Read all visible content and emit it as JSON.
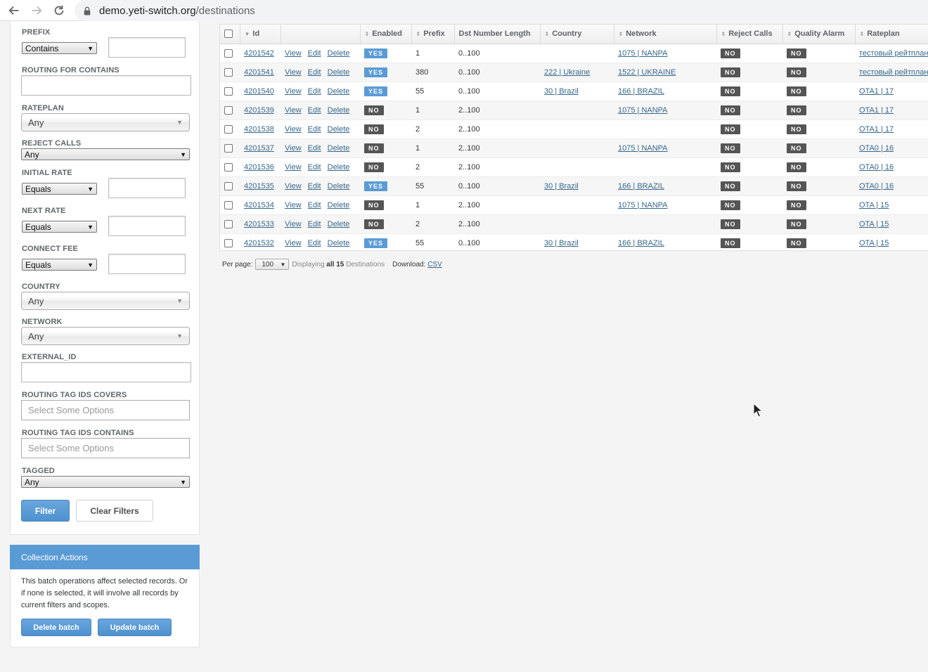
{
  "browser": {
    "url_host": "demo.yeti-switch.org",
    "url_path": "/destinations"
  },
  "filters": {
    "prefix_label": "PREFIX",
    "prefix_op": "Contains",
    "routing_for_contains_label": "ROUTING FOR CONTAINS",
    "rateplan_label": "RATEPLAN",
    "rateplan_value": "Any",
    "reject_calls_label": "REJECT CALLS",
    "reject_calls_value": "Any",
    "initial_rate_label": "INITIAL RATE",
    "initial_rate_op": "Equals",
    "next_rate_label": "NEXT RATE",
    "next_rate_op": "Equals",
    "connect_fee_label": "CONNECT FEE",
    "connect_fee_op": "Equals",
    "country_label": "COUNTRY",
    "country_value": "Any",
    "network_label": "NETWORK",
    "network_value": "Any",
    "external_id_label": "EXTERNAL_ID",
    "tag_covers_label": "ROUTING TAG IDS COVERS",
    "tag_covers_placeholder": "Select Some Options",
    "tag_contains_label": "ROUTING TAG IDS CONTAINS",
    "tag_contains_placeholder": "Select Some Options",
    "tagged_label": "TAGGED",
    "tagged_value": "Any",
    "filter_button": "Filter",
    "clear_button": "Clear Filters"
  },
  "collection_actions": {
    "title": "Collection Actions",
    "text": "This batch operations affect selected records. Or if none is selected, it will involve all records by current filters and scopes.",
    "delete_batch": "Delete batch",
    "update_batch": "Update batch"
  },
  "table": {
    "headers": [
      "Id",
      "",
      "Enabled",
      "Prefix",
      "Dst Number Length",
      "Country",
      "Network",
      "Reject Calls",
      "Quality Alarm",
      "Rateplan"
    ],
    "action_labels": [
      "View",
      "Edit",
      "Delete"
    ],
    "rows": [
      {
        "id": "4201542",
        "enabled": "YES",
        "prefix": "1",
        "len": "0..100",
        "country": "",
        "network": "1075 | NANPA",
        "reject": "NO",
        "alarm": "NO",
        "rateplan": "тестовый рейтплан"
      },
      {
        "id": "4201541",
        "enabled": "YES",
        "prefix": "380",
        "len": "0..100",
        "country": "222 | Ukraine",
        "network": "1522 | UKRAINE",
        "reject": "NO",
        "alarm": "NO",
        "rateplan": "тестовый рейтплан"
      },
      {
        "id": "4201540",
        "enabled": "YES",
        "prefix": "55",
        "len": "0..100",
        "country": "30 | Brazil",
        "network": "166 | BRAZIL",
        "reject": "NO",
        "alarm": "NO",
        "rateplan": "OTA1 | 17"
      },
      {
        "id": "4201539",
        "enabled": "NO",
        "prefix": "1",
        "len": "2..100",
        "country": "",
        "network": "1075 | NANPA",
        "reject": "NO",
        "alarm": "NO",
        "rateplan": "OTA1 | 17"
      },
      {
        "id": "4201538",
        "enabled": "NO",
        "prefix": "2",
        "len": "2..100",
        "country": "",
        "network": "",
        "reject": "NO",
        "alarm": "NO",
        "rateplan": "OTA1 | 17"
      },
      {
        "id": "4201537",
        "enabled": "NO",
        "prefix": "1",
        "len": "2..100",
        "country": "",
        "network": "1075 | NANPA",
        "reject": "NO",
        "alarm": "NO",
        "rateplan": "OTA0 | 16"
      },
      {
        "id": "4201536",
        "enabled": "NO",
        "prefix": "2",
        "len": "2..100",
        "country": "",
        "network": "",
        "reject": "NO",
        "alarm": "NO",
        "rateplan": "OTA0 | 16"
      },
      {
        "id": "4201535",
        "enabled": "YES",
        "prefix": "55",
        "len": "0..100",
        "country": "30 | Brazil",
        "network": "166 | BRAZIL",
        "reject": "NO",
        "alarm": "NO",
        "rateplan": "OTA0 | 16"
      },
      {
        "id": "4201534",
        "enabled": "NO",
        "prefix": "1",
        "len": "2..100",
        "country": "",
        "network": "1075 | NANPA",
        "reject": "NO",
        "alarm": "NO",
        "rateplan": "OTA | 15"
      },
      {
        "id": "4201533",
        "enabled": "NO",
        "prefix": "2",
        "len": "2..100",
        "country": "",
        "network": "",
        "reject": "NO",
        "alarm": "NO",
        "rateplan": "OTA | 15"
      },
      {
        "id": "4201532",
        "enabled": "YES",
        "prefix": "55",
        "len": "0..100",
        "country": "30 | Brazil",
        "network": "166 | BRAZIL",
        "reject": "NO",
        "alarm": "NO",
        "rateplan": "OTA | 15"
      }
    ]
  },
  "pagination": {
    "per_page_label": "Per page:",
    "per_page_value": "100",
    "displaying_prefix": "Displaying",
    "displaying_bold": "all 15",
    "displaying_suffix": "Destinations",
    "download_label": "Download:",
    "csv_label": "CSV"
  }
}
